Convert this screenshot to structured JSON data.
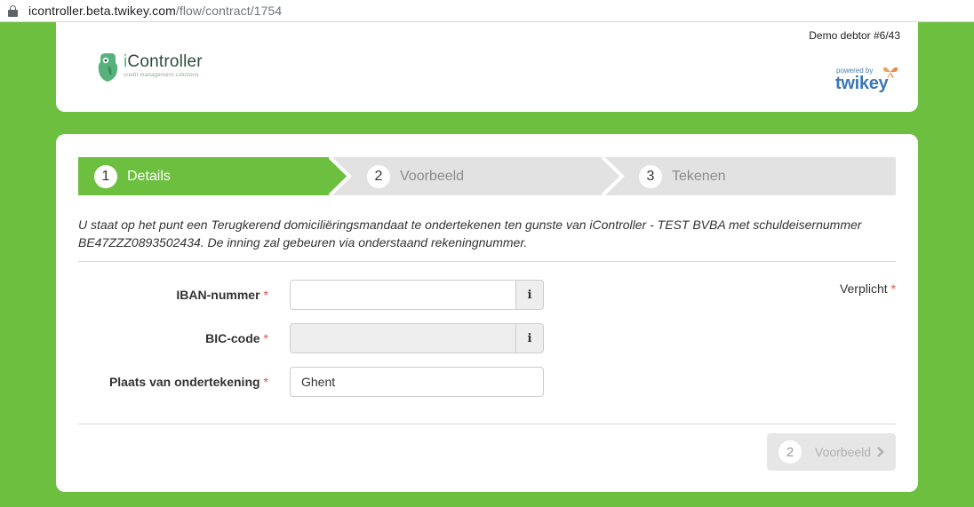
{
  "browser": {
    "url_host": "icontroller.beta.twikey.com",
    "url_path": "/flow/contract/1754"
  },
  "header": {
    "debtor": "Demo debtor #6/43",
    "logo_name_prefix": "i",
    "logo_name_rest": "Controller",
    "logo_tagline": "credit management solutions",
    "powered_label": "powered by",
    "powered_brand": "twikey"
  },
  "stepper": {
    "steps": [
      {
        "number": "1",
        "label": "Details",
        "active": true
      },
      {
        "number": "2",
        "label": "Voorbeeld",
        "active": false
      },
      {
        "number": "3",
        "label": "Tekenen",
        "active": false
      }
    ]
  },
  "intro": "U staat op het punt een Terugkerend domiciliëringsmandaat te ondertekenen ten gunste van iController - TEST BVBA met schuldeisernummer BE47ZZZ0893502434. De inning zal gebeuren via onderstaand rekeningnummer.",
  "required_note": {
    "label": "Verplicht",
    "star": "*"
  },
  "form": {
    "iban": {
      "label": "IBAN-nummer",
      "star": "*",
      "value": "",
      "info": "i"
    },
    "bic": {
      "label": "BIC-code",
      "star": "*",
      "value": "",
      "info": "i"
    },
    "place": {
      "label": "Plaats van ondertekening",
      "star": "*",
      "value": "Ghent"
    }
  },
  "next_button": {
    "number": "2",
    "label": "Voorbeeld"
  },
  "colors": {
    "brand_green": "#6dbf40",
    "step_inactive": "#e2e2e2",
    "required_star": "#d9534f"
  }
}
